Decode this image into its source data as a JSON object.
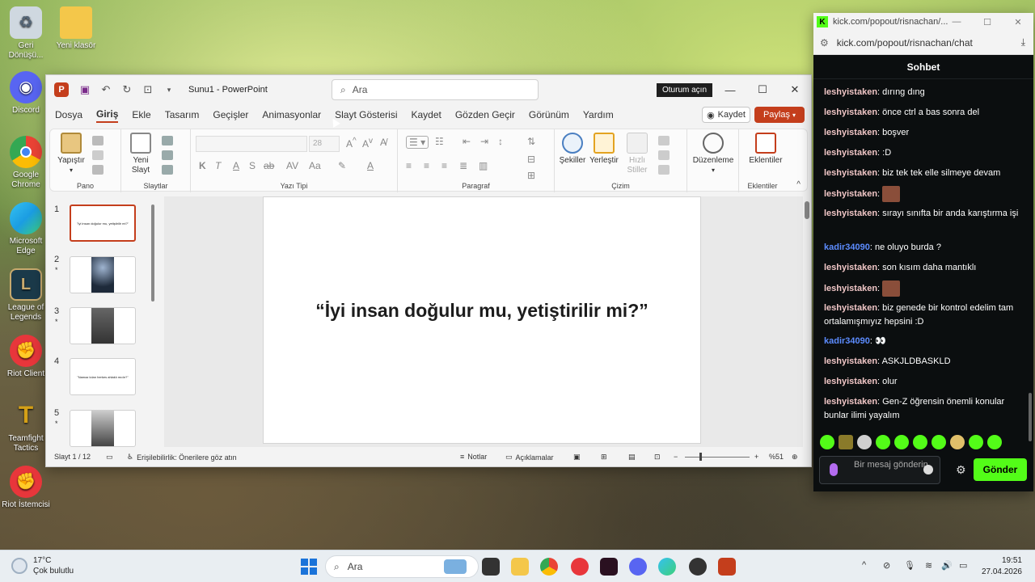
{
  "desktop": {
    "icons": [
      {
        "label": "Geri\nDönüşü...",
        "icon": "recycle-bin-icon",
        "color": "#cfd8e0"
      },
      {
        "label": "Yeni klasör",
        "icon": "folder-icon",
        "color": "#f4c74a"
      },
      {
        "label": "Discord",
        "icon": "discord-icon",
        "color": "#5865f2"
      },
      {
        "label": "Google\nChrome",
        "icon": "chrome-icon",
        "color": "#34a853"
      },
      {
        "label": "Microsoft\nEdge",
        "icon": "edge-icon",
        "color": "#1b9de2"
      },
      {
        "label": "League of\nLegends",
        "icon": "league-icon",
        "color": "#1b3a4a"
      },
      {
        "label": "Riot Client",
        "icon": "riot-client-icon",
        "color": "#e8363b"
      },
      {
        "label": "Teamfight\nTactics",
        "icon": "tft-icon",
        "color": "#d4a017"
      },
      {
        "label": "Riot İstemcisi",
        "icon": "riot-client-icon",
        "color": "#e8363b"
      }
    ]
  },
  "powerpoint": {
    "title": "Sunu1  -  PowerPoint",
    "search_placeholder": "Ara",
    "signin": "Oturum açın",
    "menu": [
      "Dosya",
      "Giriş",
      "Ekle",
      "Tasarım",
      "Geçişler",
      "Animasyonlar",
      "Slayt Gösterisi",
      "Kaydet",
      "Gözden Geçir",
      "Görünüm",
      "Yardım"
    ],
    "active_menu": "Giriş",
    "kaydet_button": "Kaydet",
    "paylas_button": "Paylaş",
    "ribbon": {
      "pano_label": "Pano",
      "yapistir": "Yapıştır",
      "slaytlar_label": "Slaytlar",
      "yeni_slayt": "Yeni\nSlayt",
      "yazi_tipi_label": "Yazı Tipi",
      "font_size": "28",
      "paragraf_label": "Paragraf",
      "cizim_label": "Çizim",
      "sekiller": "Şekiller",
      "yerlestir": "Yerleştir",
      "hizli_stiller": "Hızlı\nStiller",
      "duzenleme": "Düzenleme",
      "eklentiler": "Eklentiler",
      "eklentiler_label": "Eklentiler"
    },
    "slides": [
      {
        "num": "1",
        "text": "\"İyi insan doğulur mu, yetiştirilir mi?\"",
        "star": ""
      },
      {
        "num": "2",
        "text": "",
        "star": "*"
      },
      {
        "num": "3",
        "text": "",
        "star": "*"
      },
      {
        "num": "4",
        "text": "\"Namaz kılan herkes ahlaklı mıdır?\"",
        "star": ""
      },
      {
        "num": "5",
        "text": "",
        "star": "*"
      }
    ],
    "current_slide_text": "“İyi insan doğulur mu, yetiştirilir mi?”",
    "status": {
      "slide_counter": "Slayt 1 / 12",
      "accessibility": "Erişilebilirlik: Önerilere göz atın",
      "notes": "Notlar",
      "comments": "Açıklamalar",
      "zoom": "%51"
    }
  },
  "chat": {
    "tab_url": "kick.com/popout/risnachan/...",
    "address": "kick.com/popout/risnachan/chat",
    "header": "Sohbet",
    "messages": [
      {
        "user": "leshyistaken",
        "text": "dırıng dıng",
        "emote": false
      },
      {
        "user": "leshyistaken",
        "text": "önce ctrl a bas sonra del",
        "emote": false
      },
      {
        "user": "leshyistaken",
        "text": "boşver",
        "emote": false
      },
      {
        "user": "leshyistaken",
        "text": ":D",
        "emote": false
      },
      {
        "user": "leshyistaken",
        "text": "biz tek tek elle silmeye devam",
        "emote": false
      },
      {
        "user": "leshyistaken",
        "text": "",
        "emote": true
      },
      {
        "user": "leshyistaken",
        "text": "sırayı sınıfta bir anda karıştırma işi",
        "emote": false
      },
      {
        "user": "kadir34090",
        "text": "ne oluyo burda ?",
        "emote": false
      },
      {
        "user": "leshyistaken",
        "text": "son kısım daha mantıklı",
        "emote": false
      },
      {
        "user": "leshyistaken",
        "text": "",
        "emote": true
      },
      {
        "user": "leshyistaken",
        "text": "biz genede bir kontrol edelim tam ortalamışmıyız hepsini :D",
        "emote": false
      },
      {
        "user": "kadir34090",
        "text": "👀",
        "emote": false
      },
      {
        "user": "leshyistaken",
        "text": "ASKJLDBASKLD",
        "emote": false
      },
      {
        "user": "leshyistaken",
        "text": "olur",
        "emote": false
      },
      {
        "user": "leshyistaken",
        "text": "Gen-Z öğrensin önemli konular bunlar ilimi yayalım",
        "emote": false
      }
    ],
    "input_placeholder": "Bir mesaj gönderin",
    "send_button": "Gönder"
  },
  "taskbar": {
    "temperature": "17°C",
    "weather": "Çok bulutlu",
    "search": "Ara",
    "time": "19:51",
    "date": "27.04.2026"
  }
}
